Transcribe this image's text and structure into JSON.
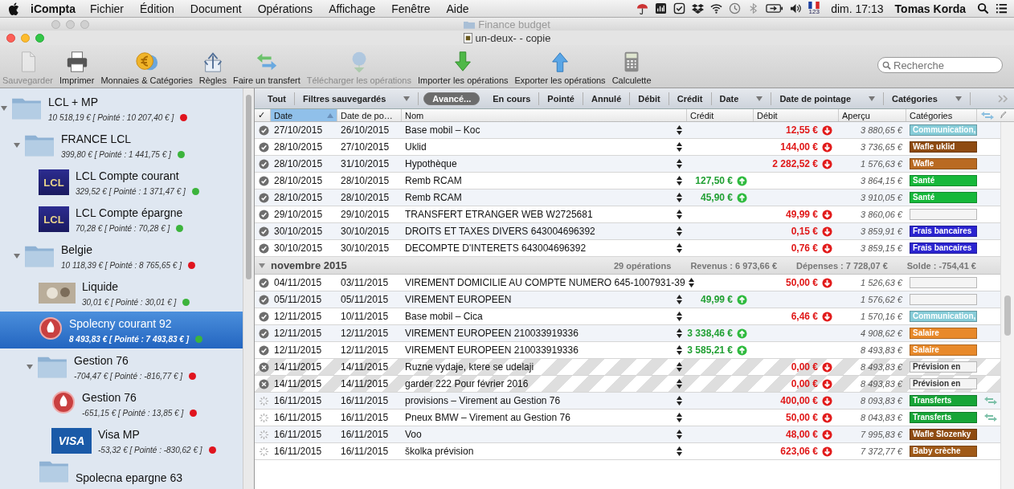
{
  "menubar": {
    "app": "iCompta",
    "menus": [
      "Fichier",
      "Édition",
      "Document",
      "Opérations",
      "Affichage",
      "Fenêtre",
      "Aide"
    ],
    "input_source": "123",
    "clock": "dim. 17:13",
    "user": "Tomas Korda"
  },
  "background_window": {
    "title": "Finance budget"
  },
  "window": {
    "title": "un-deux- - copie"
  },
  "toolbar": {
    "items": [
      {
        "label": "Sauvegarder",
        "kind": "document",
        "disabled": true
      },
      {
        "label": "Imprimer",
        "kind": "printer",
        "disabled": false
      },
      {
        "label": "Monnaies & Catégories",
        "kind": "coin",
        "disabled": false
      },
      {
        "label": "Règles",
        "kind": "rules",
        "disabled": false
      },
      {
        "label": "Faire un transfert",
        "kind": "transfer",
        "disabled": false
      },
      {
        "label": "Télécharger les opérations",
        "kind": "globe",
        "disabled": true
      },
      {
        "label": "Importer les opérations",
        "kind": "import",
        "disabled": false
      },
      {
        "label": "Exporter les opérations",
        "kind": "export",
        "disabled": false
      },
      {
        "label": "Calculette",
        "kind": "calculator",
        "disabled": false
      }
    ],
    "search": {
      "placeholder": "Recherche"
    }
  },
  "sidebar": {
    "accounts": [
      {
        "name": "LCL + MP",
        "balance": "10 518,19 € [ Pointé : 10 207,40 € ]",
        "kind": "folder",
        "color": "#e0141e",
        "expanded": true,
        "selected": false,
        "children": [
          {
            "name": "FRANCE LCL",
            "balance": "399,80 € [ Pointé : 1 441,75 € ]",
            "kind": "folder",
            "color": "#3cb43c",
            "expanded": true,
            "selected": false,
            "children": [
              {
                "name": "LCL Compte courant",
                "balance": "329,52 € [ Pointé : 1 371,47 € ]",
                "kind": "bank",
                "logo_text": "LCL",
                "color": "#3cb43c",
                "selected": false
              },
              {
                "name": "LCL Compte épargne",
                "balance": "70,28 € [ Pointé : 70,28 € ]",
                "kind": "bank",
                "logo_text": "LCL",
                "color": "#3cb43c",
                "selected": false
              }
            ]
          },
          {
            "name": "Belgie",
            "balance": "10 118,39 € [ Pointé : 8 765,65 € ]",
            "kind": "folder",
            "color": "#e0141e",
            "expanded": true,
            "selected": false,
            "children": [
              {
                "name": "Liquide",
                "balance": "30,01 € [ Pointé : 30,01 € ]",
                "kind": "banknote",
                "color": "#3cb43c",
                "selected": false
              },
              {
                "name": "Spolecny courant 92",
                "balance": "8 493,83 € [ Pointé : 7 493,83 € ]",
                "kind": "seal",
                "color": "#3cb43c",
                "selected": true
              },
              {
                "name": "Gestion 76",
                "balance": "-704,47 € [ Pointé : -816,77 € ]",
                "kind": "folder",
                "color": "#e0141e",
                "expanded": true,
                "selected": false,
                "children": [
                  {
                    "name": "Gestion 76",
                    "balance": "-651,15 € [ Pointé : 13,85 € ]",
                    "kind": "seal",
                    "color": "#e0141e",
                    "selected": false
                  },
                  {
                    "name": "Visa MP",
                    "balance": "-53,32 € [ Pointé : -830,62 € ]",
                    "kind": "card",
                    "logo_text": "VISA",
                    "color": "#e0141e",
                    "selected": false
                  }
                ]
              },
              {
                "name": "Spolecna epargne 63",
                "kind": "folder",
                "selected": false
              }
            ]
          }
        ]
      }
    ]
  },
  "filters": [
    {
      "label": "Tout",
      "kind": "plain",
      "selected": false
    },
    {
      "label": "Filtres sauvegardés",
      "kind": "menu",
      "selected": false
    },
    {
      "label": "Avancé...",
      "kind": "pill",
      "selected": true
    },
    {
      "label": "En cours",
      "kind": "plain",
      "selected": false
    },
    {
      "label": "Pointé",
      "kind": "plain",
      "selected": false
    },
    {
      "label": "Annulé",
      "kind": "plain",
      "selected": false
    },
    {
      "label": "Débit",
      "kind": "plain",
      "selected": false
    },
    {
      "label": "Crédit",
      "kind": "plain",
      "selected": false
    },
    {
      "label": "Date",
      "kind": "menu",
      "selected": false
    },
    {
      "label": "Date de pointage",
      "kind": "menu",
      "selected": false
    },
    {
      "label": "Catégories",
      "kind": "menu",
      "selected": false
    }
  ],
  "table": {
    "columns": [
      {
        "label": "✓",
        "selected": false
      },
      {
        "label": "Date",
        "selected": true
      },
      {
        "label": "Date de po…",
        "selected": false
      },
      {
        "label": "Nom",
        "selected": false
      },
      {
        "label": "Crédit",
        "selected": false
      },
      {
        "label": "Débit",
        "selected": false
      },
      {
        "label": "Aperçu",
        "selected": false
      },
      {
        "label": "Catégories",
        "selected": false
      }
    ],
    "rows": [
      {
        "kind": "pointed",
        "date": "27/10/2015",
        "date2": "26/10/2015",
        "name": "Base mobil – Koc",
        "debit": "12,55 €",
        "preview": "3 880,65 €",
        "category": {
          "label": "Communication,",
          "color": "#86ccd8"
        },
        "transfer": false
      },
      {
        "kind": "pointed",
        "date": "28/10/2015",
        "date2": "27/10/2015",
        "name": "Uklid",
        "debit": "144,00 €",
        "preview": "3 736,65 €",
        "category": {
          "label": "Wafle uklid",
          "color": "#8e4b12"
        },
        "transfer": false
      },
      {
        "kind": "pointed",
        "date": "28/10/2015",
        "date2": "31/10/2015",
        "name": "Hypothèque",
        "debit": "2 282,52 €",
        "preview": "1 576,63 €",
        "category": {
          "label": "Wafle",
          "color": "#b96a22"
        },
        "transfer": false
      },
      {
        "kind": "pointed",
        "date": "28/10/2015",
        "date2": "28/10/2015",
        "name": "Remb RCAM",
        "credit": "127,50 €",
        "preview": "3 864,15 €",
        "category": {
          "label": "Santé",
          "color": "#16b83a"
        },
        "transfer": false
      },
      {
        "kind": "pointed",
        "date": "28/10/2015",
        "date2": "28/10/2015",
        "name": "Remb RCAM",
        "credit": "45,90 €",
        "preview": "3 910,05 €",
        "category": {
          "label": "Santé",
          "color": "#16b83a"
        },
        "transfer": false
      },
      {
        "kind": "pointed",
        "date": "29/10/2015",
        "date2": "29/10/2015",
        "name": "TRANSFERT ETRANGER WEB W2725681",
        "debit": "49,99 €",
        "preview": "3 860,06 €",
        "category": {
          "color": "#f4f4f4"
        },
        "transfer": false
      },
      {
        "kind": "pointed",
        "date": "30/10/2015",
        "date2": "30/10/2015",
        "name": "DROITS ET TAXES DIVERS 643004696392",
        "debit": "0,15 €",
        "preview": "3 859,91 €",
        "category": {
          "label": "Frais bancaires",
          "color": "#2b24d0"
        },
        "transfer": false
      },
      {
        "kind": "pointed",
        "date": "30/10/2015",
        "date2": "30/10/2015",
        "name": "DECOMPTE D'INTERETS 643004696392",
        "debit": "0,76 €",
        "preview": "3 859,15 €",
        "category": {
          "label": "Frais bancaires",
          "color": "#2b24d0"
        },
        "transfer": false
      },
      {
        "kind": "group",
        "title": "novembre 2015",
        "expanded": true,
        "count": "29 opérations",
        "income": "Revenus : 6 973,66 €",
        "expenses": "Dépenses : 7 728,07 €",
        "balance": "Solde : -754,41 €"
      },
      {
        "kind": "pointed",
        "date": "04/11/2015",
        "date2": "03/11/2015",
        "name": "VIREMENT DOMICILIE AU COMPTE NUMERO 645-1007931-39",
        "debit": "50,00 €",
        "preview": "1 526,63 €",
        "category": {
          "color": "#f4f4f4"
        },
        "transfer": false
      },
      {
        "kind": "pointed",
        "date": "05/11/2015",
        "date2": "05/11/2015",
        "name": "VIREMENT EUROPEEN",
        "credit": "49,99 €",
        "preview": "1 576,62 €",
        "category": {
          "color": "#f4f4f4"
        },
        "transfer": false
      },
      {
        "kind": "pointed",
        "date": "12/11/2015",
        "date2": "10/11/2015",
        "name": "Base mobil – Cica",
        "debit": "6,46 €",
        "preview": "1 570,16 €",
        "category": {
          "label": "Communication,",
          "color": "#86ccd8"
        },
        "transfer": false
      },
      {
        "kind": "pointed",
        "date": "12/11/2015",
        "date2": "12/11/2015",
        "name": "VIREMENT EUROPEEN 210033919336",
        "credit": "3 338,46 €",
        "preview": "4 908,62 €",
        "category": {
          "label": "Salaire",
          "color": "#e8892a"
        },
        "transfer": false
      },
      {
        "kind": "pointed",
        "date": "12/11/2015",
        "date2": "12/11/2015",
        "name": "VIREMENT EUROPEEN 210033919336",
        "credit": "3 585,21 €",
        "preview": "8 493,83 €",
        "category": {
          "label": "Salaire",
          "color": "#e8892a"
        },
        "transfer": false
      },
      {
        "kind": "cancelled",
        "date": "14/11/2015",
        "date2": "14/11/2015",
        "name": "Ruzne vydaje, ktere se udelaji",
        "debit": "0,00 €",
        "preview": "8 493,83 €",
        "category": {
          "label": "Prévision en",
          "color": "#f4f4f4"
        },
        "transfer": false
      },
      {
        "kind": "cancelled",
        "date": "14/11/2015",
        "date2": "14/11/2015",
        "name": "garder 222 Pour février 2016",
        "debit": "0,00 €",
        "preview": "8 493,83 €",
        "category": {
          "label": "Prévision en",
          "color": "#f4f4f4"
        },
        "transfer": false
      },
      {
        "kind": "pending",
        "date": "16/11/2015",
        "date2": "16/11/2015",
        "name": "provisions – Virement au Gestion 76",
        "debit": "400,00 €",
        "preview": "8 093,83 €",
        "category": {
          "label": "Transferts",
          "color": "#17a537"
        },
        "transfer": true
      },
      {
        "kind": "pending",
        "date": "16/11/2015",
        "date2": "16/11/2015",
        "name": "Pneux BMW – Virement au Gestion 76",
        "debit": "50,00 €",
        "preview": "8 043,83 €",
        "category": {
          "label": "Transferts",
          "color": "#17a537"
        },
        "transfer": true
      },
      {
        "kind": "pending",
        "date": "16/11/2015",
        "date2": "16/11/2015",
        "name": "Voo",
        "debit": "48,00 €",
        "preview": "7 995,83 €",
        "category": {
          "label": "Wafle Slozenky",
          "color": "#8e4b12"
        },
        "transfer": false
      },
      {
        "kind": "pending",
        "date": "16/11/2015",
        "date2": "16/11/2015",
        "name": "školka prévision",
        "debit": "623,06 €",
        "preview": "7 372,77 €",
        "category": {
          "label": "Baby crèche",
          "color": "#a05a18"
        },
        "transfer": false
      }
    ]
  }
}
